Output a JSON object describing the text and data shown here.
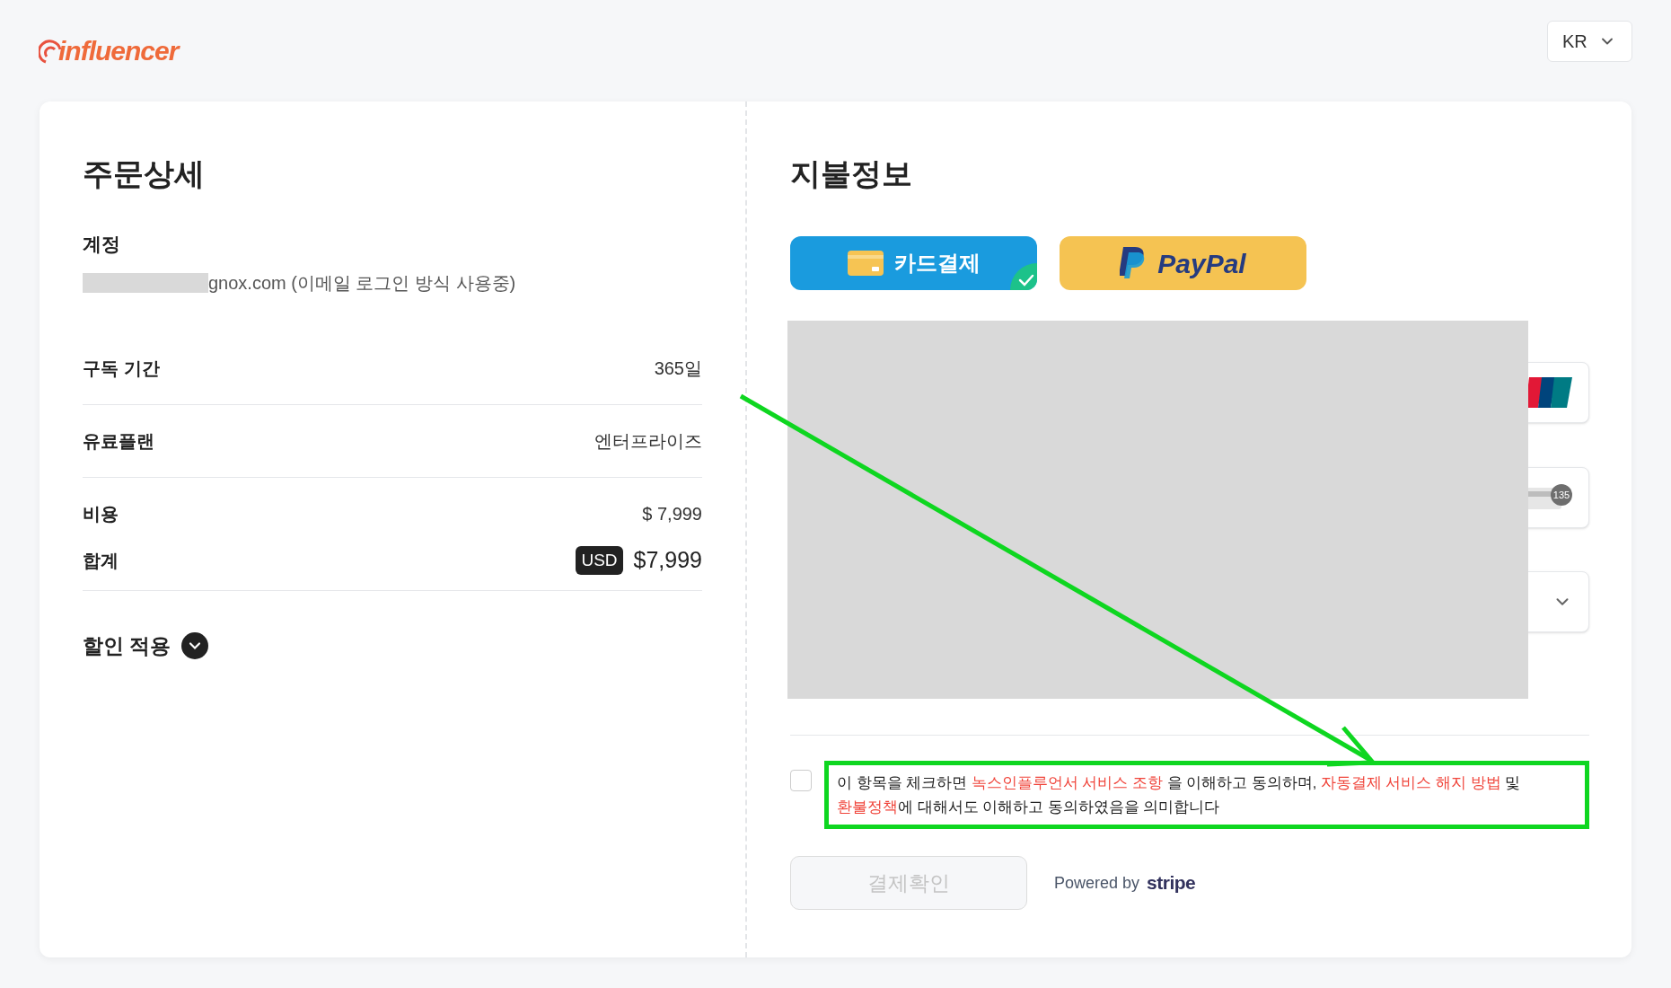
{
  "header": {
    "logo": "influencer",
    "language": "KR"
  },
  "order": {
    "title": "주문상세",
    "account_label": "계정",
    "account_value": "gnox.com (이메일 로그인 방식 사용중)",
    "rows": [
      {
        "label": "구독 기간",
        "value": "365일"
      },
      {
        "label": "유료플랜",
        "value": "엔터프라이즈"
      },
      {
        "label": "비용",
        "value": "$ 7,999"
      }
    ],
    "total": {
      "label": "합계",
      "currency": "USD",
      "value": "$7,999"
    },
    "discount": {
      "label": "할인 적용",
      "expanded": false
    }
  },
  "payment": {
    "title": "지불정보",
    "methods": [
      {
        "kind": "card",
        "label": "카드결제",
        "selected": true
      },
      {
        "kind": "paypal",
        "label": "PayPal",
        "selected": false
      }
    ],
    "cvc_hint": "135",
    "consent": {
      "checked": false,
      "segments": [
        {
          "kind": "plain",
          "text": "이 항목을 체크하면 "
        },
        {
          "kind": "link",
          "text": "녹스인플루언서 서비스 조항"
        },
        {
          "kind": "plain",
          "text": " 을 이해하고 동의하며, "
        },
        {
          "kind": "link",
          "text": "자동결제 서비스 해지 방법"
        },
        {
          "kind": "plain",
          "text": " 및 "
        },
        {
          "kind": "link",
          "text": "환불정책"
        },
        {
          "kind": "plain",
          "text": "에 대해서도 이해하고 동의하였음을 의미합니다"
        }
      ]
    },
    "confirm": {
      "label": "결제확인",
      "disabled": true
    },
    "powered_by": "Powered by",
    "stripe": "stripe"
  }
}
